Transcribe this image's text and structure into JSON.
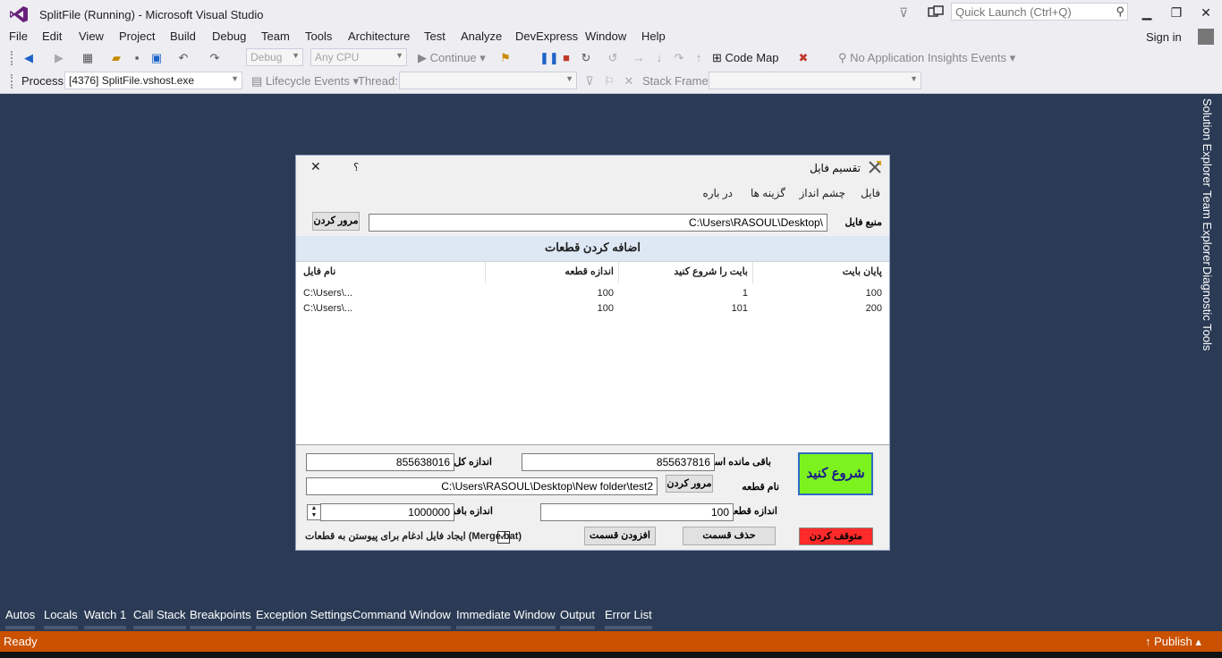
{
  "window": {
    "title": "SplitFile (Running) - Microsoft Visual Studio",
    "quick_launch_placeholder": "Quick Launch (Ctrl+Q)"
  },
  "menu": [
    "File",
    "Edit",
    "View",
    "Project",
    "Build",
    "Debug",
    "Team",
    "Tools",
    "Architecture",
    "Test",
    "Analyze",
    "DevExpress",
    "Window",
    "Help"
  ],
  "account": {
    "sign_in": "Sign in"
  },
  "toolbar1": {
    "config": "Debug",
    "platform": "Any CPU",
    "continue": "Continue",
    "code_map": "Code Map",
    "insights": "No Application Insights Events"
  },
  "toolbar2": {
    "process_label": "Process:",
    "process_value": "[4376] SplitFile.vshost.exe",
    "lifecycle": "Lifecycle Events",
    "thread_label": "Thread:",
    "stack_frame_label": "Stack Frame:"
  },
  "side_tabs": [
    "Solution Explorer",
    "Team Explorer",
    "Diagnostic Tools"
  ],
  "bottom_tabs": [
    "Autos",
    "Locals",
    "Watch 1",
    "Call Stack",
    "Breakpoints",
    "Exception Settings",
    "Command Window",
    "Immediate Window",
    "Output",
    "Error List"
  ],
  "status": {
    "ready": "Ready",
    "publish": "Publish"
  },
  "dialog": {
    "title": "تقسیم فایل",
    "help": "؟",
    "menu": [
      "فایل",
      "چشم انداز",
      "گزینه ها",
      "در باره"
    ],
    "source_label": "منبع فایل",
    "source_path": "C:\\Users\\RASOUL\\Desktop\\",
    "browse": "مرور کردن",
    "add_header": "اضافه کردن قطعات",
    "columns": [
      "پایان بایت",
      "بایت را شروع کنید",
      "اندازه قطعه",
      "نام فایل"
    ],
    "rows": [
      {
        "end": "100",
        "start": "1",
        "size": "100",
        "name": "C:\\Users\\..."
      },
      {
        "end": "200",
        "start": "101",
        "size": "100",
        "name": "C:\\Users\\..."
      }
    ],
    "remaining_label": "باقی مانده است",
    "remaining_value": "855637816",
    "total_label": "اندازه کل",
    "total_value": "855638016",
    "piece_name_label": "نام قطعه",
    "piece_name_value": "C:\\Users\\RASOUL\\Desktop\\New folder\\test2",
    "browse2": "مرور کردن",
    "piece_size_label": "اندازه قطعه",
    "piece_size_value": "100",
    "buffer_label": "اندازه بافر",
    "buffer_value": "1000000",
    "start_button": "شروع کنید",
    "stop_button": "متوقف کردن",
    "delete_button": "حذف قسمت",
    "add_button": "افزودن قسمت",
    "merge_label": "ایجاد فایل ادغام برای پیوستن به قطعات (Merge.bat)",
    "merge_checked": true
  }
}
